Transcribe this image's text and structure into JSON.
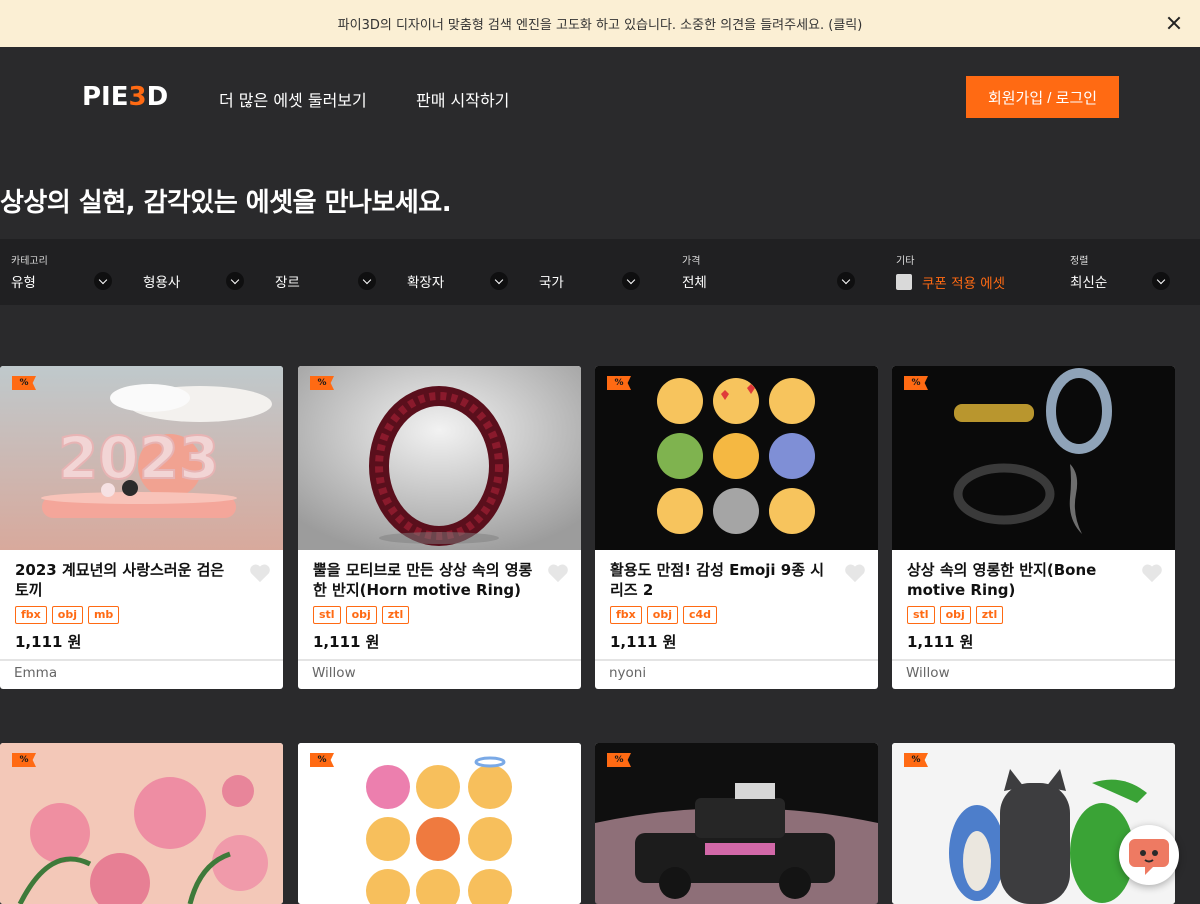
{
  "banner": {
    "text": "파이3D의 디자이너 맞춤형 검색 엔진을 고도화 하고 있습니다. 소중한 의견을 들려주세요. (클릭)"
  },
  "header": {
    "logo_pre": "PIE",
    "logo_mid": "3",
    "logo_post": "D",
    "nav": [
      "더 많은 에셋 둘러보기",
      "판매 시작하기"
    ],
    "login_label": "회원가입 / 로그인"
  },
  "hero": {
    "title": "상상의 실현, 감각있는 에셋을 만나보세요."
  },
  "filters": {
    "category_label": "카테고리",
    "category_items": [
      "유형",
      "형용사",
      "장르",
      "확장자",
      "국가"
    ],
    "price_label": "가격",
    "price_value": "전체",
    "etc_label": "기타",
    "coupon_label": "쿠폰 적용 에셋",
    "sort_label": "정렬",
    "sort_value": "최신순"
  },
  "discount_badge": "%",
  "products": [
    {
      "title": "2023 계묘년의 사랑스러운 검은 토끼",
      "tags": [
        "fbx",
        "obj",
        "mb"
      ],
      "price": "1,111 원",
      "author": "Emma"
    },
    {
      "title": "뿔을 모티브로 만든 상상 속의 영롱한 반지(Horn motive Ring)",
      "tags": [
        "stl",
        "obj",
        "ztl"
      ],
      "price": "1,111 원",
      "author": "Willow"
    },
    {
      "title": "활용도 만점! 감성 Emoji 9종 시리즈 2",
      "tags": [
        "fbx",
        "obj",
        "c4d"
      ],
      "price": "1,111 원",
      "author": "nyoni"
    },
    {
      "title": "상상 속의 영롱한 반지(Bone motive Ring)",
      "tags": [
        "stl",
        "obj",
        "ztl"
      ],
      "price": "1,111 원",
      "author": "Willow"
    }
  ],
  "colors": {
    "accent": "#ff6a13",
    "background": "#2a2a2c",
    "banner": "#fbefd4",
    "filterbar": "#202022"
  }
}
